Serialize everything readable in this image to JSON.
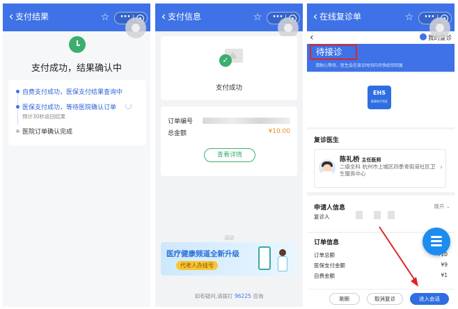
{
  "screen1": {
    "title": "支付结果",
    "result_title": "支付成功，结果确认中",
    "steps": [
      {
        "label": "自费支付成功，医保支付结果查询中"
      },
      {
        "label": "医保支付成功，等待医院确认订单",
        "note": "预计30秒返回结果"
      },
      {
        "label": "医院订单确认完成"
      }
    ]
  },
  "screen2": {
    "title": "支付信息",
    "status": "支付成功",
    "order_no_label": "订单编号",
    "total_label": "总金额",
    "total_value": "¥10.00",
    "detail_button": "查看详情",
    "activity_label": "活动",
    "banner_title": "医疗健康频道全新升级",
    "banner_sub": "代老人办挂号",
    "footer_prefix": "如有疑问,请拨打",
    "footer_phone": "96225",
    "footer_suffix": "咨询"
  },
  "screen3": {
    "title": "在线复诊单",
    "my_rx": "我的复诊",
    "status": "待接诊",
    "status_hint": "请耐心等待，医生会在接诊时间内尽快给你回复",
    "ehs_logo": "EHS",
    "ehs_caption": "医保电子凭证",
    "doctor_section": "复诊医生",
    "doctor_name": "陈礼桥",
    "doctor_title": "主任医师",
    "doctor_info": "二级全科 杭州市上城区四季青街道社区卫生服务中心",
    "applicant_section": "申请人信息",
    "expand": "展开",
    "patient_label": "复诊人",
    "order_section": "订单信息",
    "order_rows": [
      {
        "label": "订单总额",
        "value": "¥10"
      },
      {
        "label": "医保支付金额",
        "value": "¥9"
      },
      {
        "label": "自费金额",
        "value": "¥1"
      }
    ],
    "btn_refresh": "刷新",
    "btn_cancel": "取消复诊",
    "btn_enter": "进入会话"
  },
  "colors": {
    "title_bar": "#3e72e6",
    "success_green": "#3cae6e",
    "amount_orange": "#f08a24",
    "alert_red": "#e02424",
    "fab_blue": "#1d8cf0"
  },
  "icons": [
    "back-arrow-icon",
    "star-icon",
    "more-icon",
    "close-circle-icon",
    "clock-icon",
    "spinner-icon",
    "check-icon",
    "menu-icon",
    "chevron-right-icon",
    "doctor-avatar"
  ]
}
